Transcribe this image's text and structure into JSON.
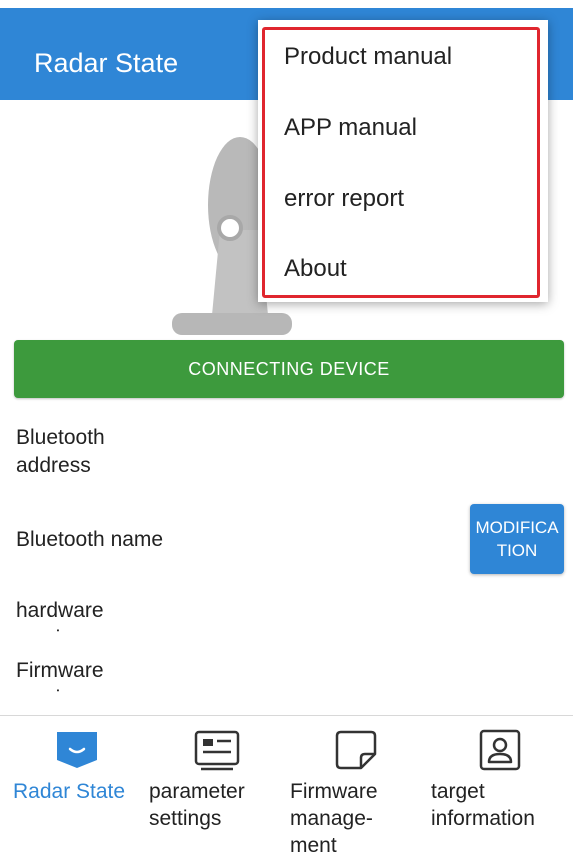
{
  "header": {
    "title": "Radar State"
  },
  "connect_button": {
    "label": "CONNECTING DEVICE"
  },
  "info": {
    "bluetooth_address_label": "Bluetooth address",
    "bluetooth_name_label": "Bluetooth name",
    "hardware_version_label": "hardware version",
    "firmware_version_label": "Firmware version",
    "modify_button_label": "MODIFICATION"
  },
  "menu": {
    "items": [
      {
        "label": "Product manual"
      },
      {
        "label": "APP manual"
      },
      {
        "label": "error report"
      },
      {
        "label": "About"
      }
    ]
  },
  "bottom_nav": {
    "items": [
      {
        "label": "Radar State",
        "icon": "radar-state-icon",
        "active": true
      },
      {
        "label": "parameter settings",
        "icon": "parameter-settings-icon",
        "active": false
      },
      {
        "label": "Firmware manage-ment",
        "icon": "firmware-management-icon",
        "active": false
      },
      {
        "label": "target information",
        "icon": "target-information-icon",
        "active": false
      }
    ]
  },
  "colors": {
    "primary": "#2f86d6",
    "connect": "#3d9a3d",
    "highlight_border": "#e0262e"
  }
}
